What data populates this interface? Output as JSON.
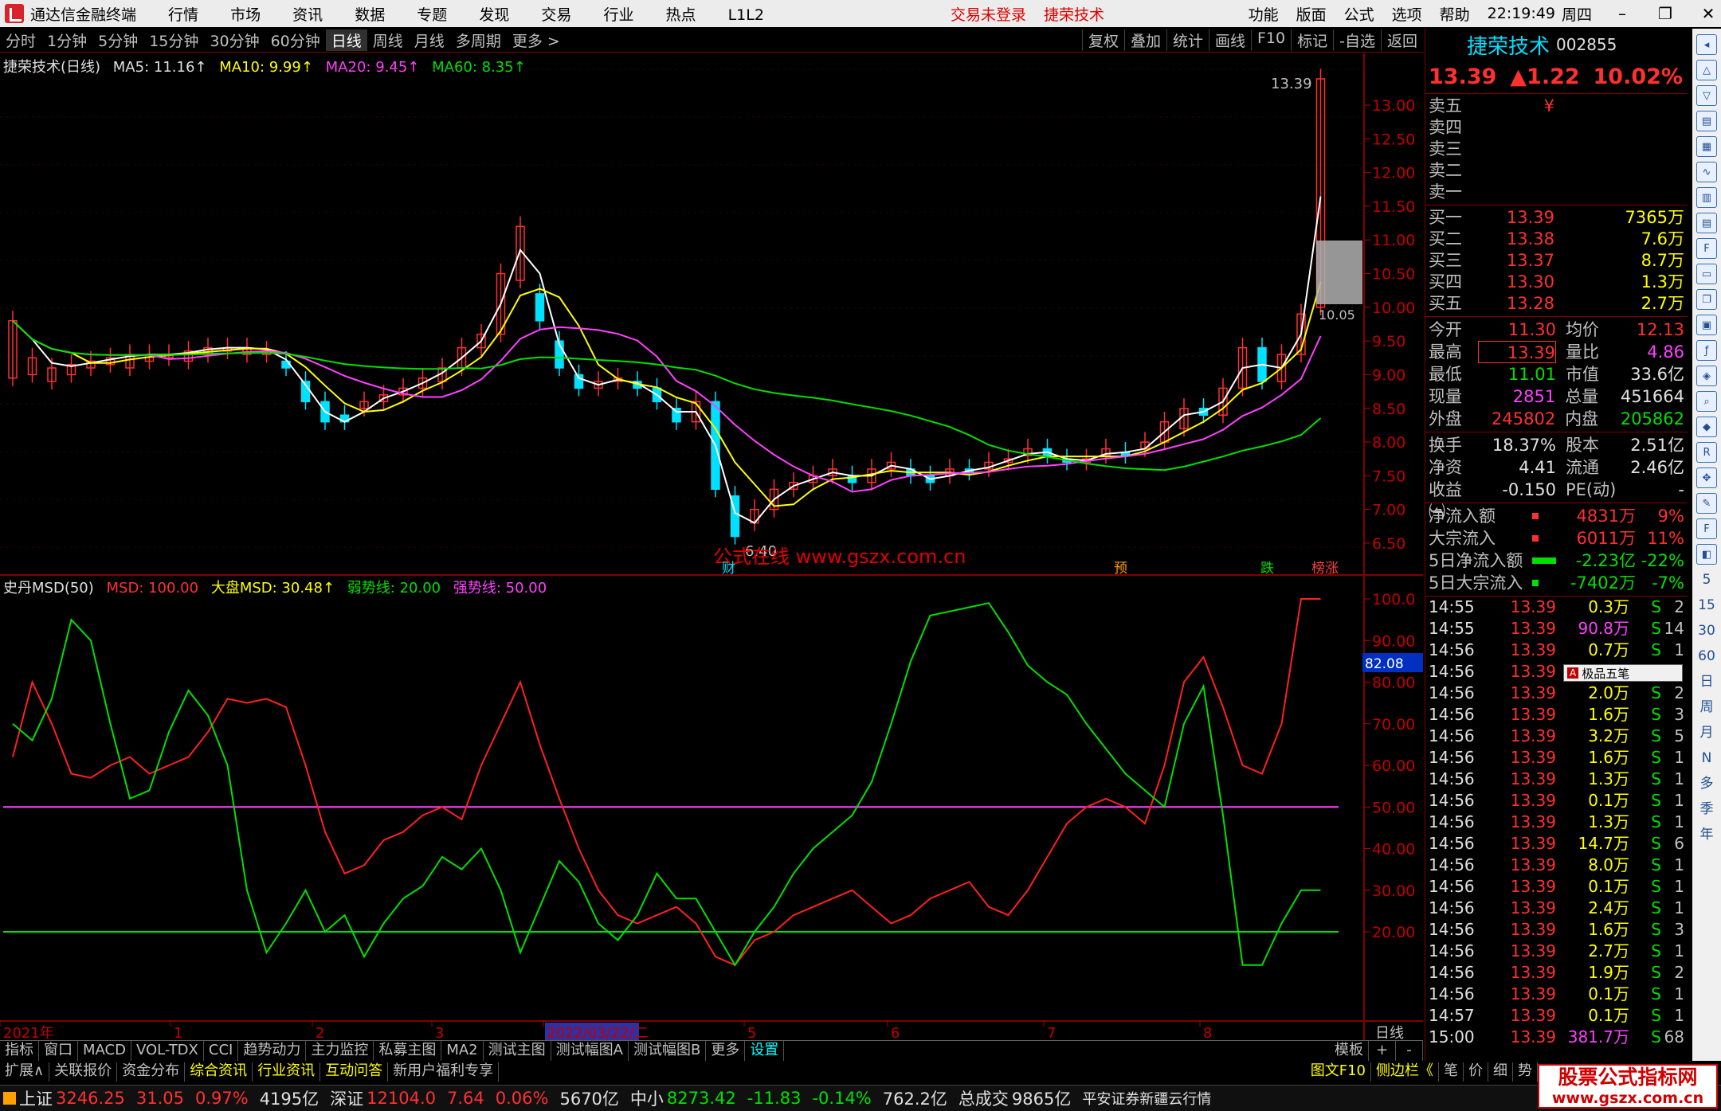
{
  "title_bar": {
    "app_name": "通达信金融终端",
    "menu": [
      "行情",
      "市场",
      "资讯",
      "数据",
      "专题",
      "发现",
      "交易",
      "行业",
      "热点",
      "L1L2"
    ],
    "warning_login": "交易未登录",
    "warning_stock": "捷荣技术",
    "right_menu": [
      "功能",
      "版面",
      "公式",
      "选项",
      "帮助"
    ],
    "clock": "22:19:49",
    "weekday": "周四"
  },
  "toolbar": {
    "periods": [
      "分时",
      "1分钟",
      "5分钟",
      "15分钟",
      "30分钟",
      "60分钟",
      "日线",
      "周线",
      "月线",
      "多周期",
      "更多 >"
    ],
    "active_period": "日线",
    "right_buttons": [
      "复权",
      "叠加",
      "统计",
      "画线",
      "F10",
      "标记",
      "-自选",
      "返回"
    ]
  },
  "main_chart": {
    "legend": {
      "name": "捷荣技术(日线)",
      "ma5": "MA5: 11.16↑",
      "ma10": "MA10: 9.99↑",
      "ma20": "MA20: 9.45↑",
      "ma60": "MA60: 8.35↑"
    },
    "y_ticks": [
      "13.00",
      "12.50",
      "12.00",
      "11.50",
      "11.00",
      "10.50",
      "10.00",
      "9.50",
      "9.00",
      "8.50",
      "8.00",
      "7.50",
      "7.00",
      "6.50"
    ],
    "high_label": "13.39",
    "low_label": "6.40",
    "hover_label": "10.05",
    "watermark": "公式在线  www.gszx.com.cn",
    "event_markers": [
      "财",
      "预",
      "跌",
      "榜涨"
    ]
  },
  "indicator_chart": {
    "legend": {
      "name": "史丹MSD(50)",
      "msd": "MSD: 100.00",
      "market_msd": "大盘MSD: 30.48↑",
      "weak_line": "弱势线: 20.00",
      "strong_line": "强势线: 50.00"
    },
    "y_ticks": [
      "100.0",
      "90.00",
      "80.00",
      "70.00",
      "60.00",
      "50.00",
      "40.00",
      "30.00",
      "20.00"
    ],
    "cursor_value": "82.08"
  },
  "x_axis": {
    "labels": [
      "2021年",
      "1",
      "2",
      "3",
      "2022/03/22/二",
      "5",
      "6",
      "7",
      "8"
    ],
    "right_label": "日线"
  },
  "tabs_row1": [
    "指标",
    "窗口",
    "MACD",
    "VOL-TDX",
    "CCI",
    "趋势动力",
    "主力监控",
    "私募主图",
    "MA2",
    "测试主图",
    "测试幅图A",
    "测试幅图B",
    "更多",
    "设置"
  ],
  "tabs_row1_right": [
    "模板",
    "+",
    "-"
  ],
  "tabs_row2": [
    "扩展∧",
    "关联报价",
    "资金分布",
    "综合资讯",
    "行业资讯",
    "互动问答",
    "新用户福利专享"
  ],
  "tabs_row2_right": [
    "图文F10",
    "侧边栏《",
    "笔",
    "价",
    "细",
    "势"
  ],
  "status_bar": [
    {
      "name": "上证",
      "value": "3246.25",
      "chg": "31.05",
      "pct": "0.97%",
      "amt": "4195亿"
    },
    {
      "name": "深证",
      "value": "12104.0",
      "chg": "7.64",
      "pct": "0.06%",
      "amt": "5670亿"
    },
    {
      "name": "中小",
      "value": "8273.42",
      "chg": "-11.83",
      "pct": "-0.14%",
      "amt": "762.2亿"
    }
  ],
  "status_total_label": "总成交",
  "status_total_value": "9865亿",
  "status_broker": "平安证券新疆云行情",
  "quote": {
    "name": "捷荣技术",
    "code": "002855",
    "price": "13.39",
    "change": "▲1.22",
    "pct": "10.02%",
    "asks": [
      {
        "label": "卖五",
        "price": "¥",
        "vol": ""
      },
      {
        "label": "卖四",
        "price": "",
        "vol": ""
      },
      {
        "label": "卖三",
        "price": "",
        "vol": ""
      },
      {
        "label": "卖二",
        "price": "",
        "vol": ""
      },
      {
        "label": "卖一",
        "price": "",
        "vol": ""
      }
    ],
    "bids": [
      {
        "label": "买一",
        "price": "13.39",
        "vol": "7365万"
      },
      {
        "label": "买二",
        "price": "13.38",
        "vol": "7.6万"
      },
      {
        "label": "买三",
        "price": "13.37",
        "vol": "8.7万"
      },
      {
        "label": "买四",
        "price": "13.30",
        "vol": "1.3万"
      },
      {
        "label": "买五",
        "price": "13.28",
        "vol": "2.7万"
      }
    ],
    "stats1": [
      {
        "a": "今开",
        "b": "11.30",
        "c": "均价",
        "d": "12.13"
      },
      {
        "a": "最高",
        "b": "13.39",
        "c": "量比",
        "d": "4.86"
      },
      {
        "a": "最低",
        "b": "11.01",
        "c": "市值",
        "d": "33.6亿"
      },
      {
        "a": "现量",
        "b": "2851",
        "c": "总量",
        "d": "451664"
      },
      {
        "a": "外盘",
        "b": "245802",
        "c": "内盘",
        "d": "205862"
      }
    ],
    "stats2": [
      {
        "a": "换手",
        "b": "18.37%",
        "c": "股本",
        "d": "2.51亿"
      },
      {
        "a": "净资",
        "b": "4.41",
        "c": "流通",
        "d": "2.46亿"
      },
      {
        "a": "收益㈠",
        "b": "-0.150",
        "c": "PE(动)",
        "d": "-"
      }
    ],
    "flows": [
      {
        "a": "净流入额",
        "b": "4831万",
        "c": "9%"
      },
      {
        "a": "大宗流入",
        "b": "6011万",
        "c": "11%"
      },
      {
        "a": "5日净流入额",
        "b": "-2.23亿",
        "c": "-22%"
      },
      {
        "a": "5日大宗流入",
        "b": "-7402万",
        "c": "-7%"
      }
    ],
    "ticks": [
      {
        "t": "14:55",
        "p": "13.39",
        "v": "0.3万",
        "s": "S",
        "n": "2"
      },
      {
        "t": "14:55",
        "p": "13.39",
        "v": "90.8万",
        "s": "S",
        "n": "14"
      },
      {
        "t": "14:56",
        "p": "13.39",
        "v": "0.7万",
        "s": "S",
        "n": "1"
      },
      {
        "t": "14:56",
        "p": "13.39",
        "v": "",
        "s": "",
        "n": ""
      },
      {
        "t": "14:56",
        "p": "13.39",
        "v": "2.0万",
        "s": "S",
        "n": "2"
      },
      {
        "t": "14:56",
        "p": "13.39",
        "v": "1.6万",
        "s": "S",
        "n": "3"
      },
      {
        "t": "14:56",
        "p": "13.39",
        "v": "3.2万",
        "s": "S",
        "n": "5"
      },
      {
        "t": "14:56",
        "p": "13.39",
        "v": "1.6万",
        "s": "S",
        "n": "1"
      },
      {
        "t": "14:56",
        "p": "13.39",
        "v": "1.3万",
        "s": "S",
        "n": "1"
      },
      {
        "t": "14:56",
        "p": "13.39",
        "v": "0.1万",
        "s": "S",
        "n": "1"
      },
      {
        "t": "14:56",
        "p": "13.39",
        "v": "1.3万",
        "s": "S",
        "n": "1"
      },
      {
        "t": "14:56",
        "p": "13.39",
        "v": "14.7万",
        "s": "S",
        "n": "6"
      },
      {
        "t": "14:56",
        "p": "13.39",
        "v": "8.0万",
        "s": "S",
        "n": "1"
      },
      {
        "t": "14:56",
        "p": "13.39",
        "v": "0.1万",
        "s": "S",
        "n": "1"
      },
      {
        "t": "14:56",
        "p": "13.39",
        "v": "2.4万",
        "s": "S",
        "n": "1"
      },
      {
        "t": "14:56",
        "p": "13.39",
        "v": "1.6万",
        "s": "S",
        "n": "3"
      },
      {
        "t": "14:56",
        "p": "13.39",
        "v": "2.7万",
        "s": "S",
        "n": "1"
      },
      {
        "t": "14:56",
        "p": "13.39",
        "v": "1.9万",
        "s": "S",
        "n": "2"
      },
      {
        "t": "14:56",
        "p": "13.39",
        "v": "0.1万",
        "s": "S",
        "n": "1"
      },
      {
        "t": "14:57",
        "p": "13.39",
        "v": "0.1万",
        "s": "S",
        "n": "1"
      },
      {
        "t": "15:00",
        "p": "13.39",
        "v": "381.7万",
        "s": "S",
        "n": "68"
      }
    ],
    "popup_tag": "A",
    "popup_label": "极品五笔"
  },
  "sidebar_icons": [
    "shrink-icon",
    "up-icon",
    "down-icon",
    "list-icon",
    "grid-icon",
    "chart-icon",
    "candle-icon",
    "news-icon",
    "f10-icon",
    "doc-icon",
    "copy-icon",
    "calc-icon",
    "f-icon",
    "map-icon",
    "search-icon",
    "shield-icon",
    "rsi-icon",
    "move-icon",
    "pen-icon",
    "fs-icon",
    "rank-icon"
  ],
  "sidebar_labels": [
    "5",
    "15",
    "30",
    "60",
    "日",
    "周",
    "月",
    "N",
    "多",
    "季",
    "年"
  ],
  "watermark_site": {
    "line1": "股票公式指标网",
    "line2": "www.gszx.com.cn"
  },
  "colors": {
    "up": "#ff3030",
    "down": "#00e0ff",
    "ma5": "#ffffff",
    "ma10": "#ffff00",
    "ma20": "#ff40ff",
    "ma60": "#00e000",
    "msd": "#ff2020",
    "market_msd": "#00e000"
  }
}
